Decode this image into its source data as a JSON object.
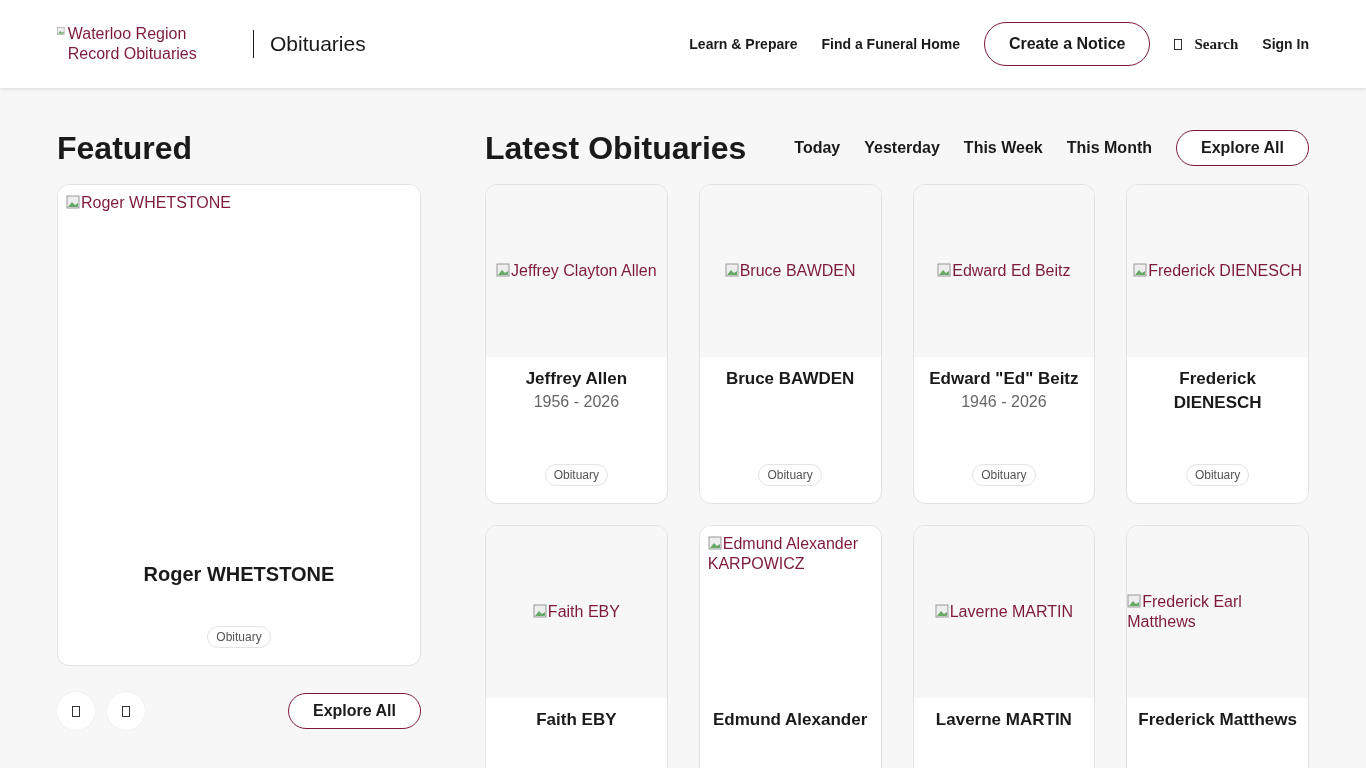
{
  "header": {
    "logo_alt": "Waterloo Region Record Obituaries",
    "section": "Obituaries",
    "nav": [
      "Learn & Prepare",
      "Find a Funeral Home"
    ],
    "cta": "Create a Notice",
    "search": "Search",
    "sign_in": "Sign In"
  },
  "featured": {
    "title": "Featured",
    "photo_alt": "Roger WHETSTONE",
    "name": "Roger WHETSTONE",
    "tag": "Obituary",
    "explore": "Explore All"
  },
  "latest": {
    "title": "Latest Obituaries",
    "filters": [
      {
        "label": "Today"
      },
      {
        "label": "Yesterday"
      },
      {
        "label": "This Week"
      },
      {
        "label": "This Month"
      }
    ],
    "explore": "Explore All",
    "cards": [
      {
        "photo_alt": "Jeffrey Clayton Allen",
        "name": "Jeffrey Allen",
        "years": "1956 - 2026",
        "tag": "Obituary"
      },
      {
        "photo_alt": "Bruce BAWDEN",
        "name": "Bruce BAWDEN",
        "tag": "Obituary"
      },
      {
        "photo_alt": "Edward Ed Beitz",
        "name": "Edward \"Ed\" Beitz",
        "years": "1946 - 2026",
        "tag": "Obituary"
      },
      {
        "photo_alt": "Frederick DIENESCH",
        "name": "Frederick DIENESCH",
        "tag": "Obituary"
      },
      {
        "photo_alt": "Faith EBY",
        "name": "Faith EBY"
      },
      {
        "photo_alt": "Edmund Alexander KARPOWICZ",
        "name": "Edmund Alexander"
      },
      {
        "photo_alt": "Laverne MARTIN",
        "name": "Laverne MARTIN"
      },
      {
        "photo_alt": "Frederick Earl Matthews",
        "name": "Frederick Matthews"
      }
    ]
  }
}
